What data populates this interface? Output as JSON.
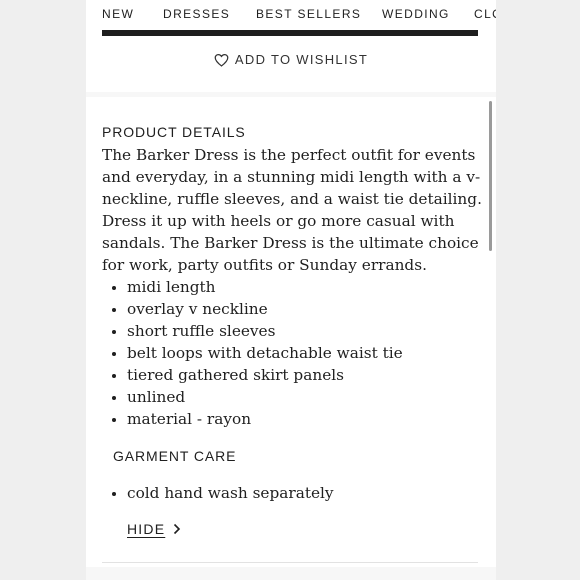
{
  "nav": {
    "items": [
      "NEW",
      "DRESSES",
      "BEST SELLERS",
      "WEDDING",
      "CLO"
    ]
  },
  "wishlist": {
    "label": "ADD TO WISHLIST",
    "icon": "heart-icon"
  },
  "product_details": {
    "title": "PRODUCT DETAILS",
    "description": "The Barker Dress is the perfect outfit for events and everyday, in a stunning midi length with a v-neckline, ruffle sleeves, and a waist tie detailing. Dress it up with heels or go more casual with sandals. The Barker Dress is the ultimate choice for work, party outfits or Sunday errands.",
    "features": [
      "midi length",
      "overlay v neckline",
      "short ruffle sleeves",
      "belt loops with detachable waist tie",
      "tiered gathered skirt panels",
      "unlined",
      "material - rayon"
    ]
  },
  "garment_care": {
    "title": "GARMENT CARE",
    "items": [
      "cold hand wash separately"
    ]
  },
  "hide_link": {
    "label": "HIDE",
    "icon": "chevron-right-icon"
  }
}
